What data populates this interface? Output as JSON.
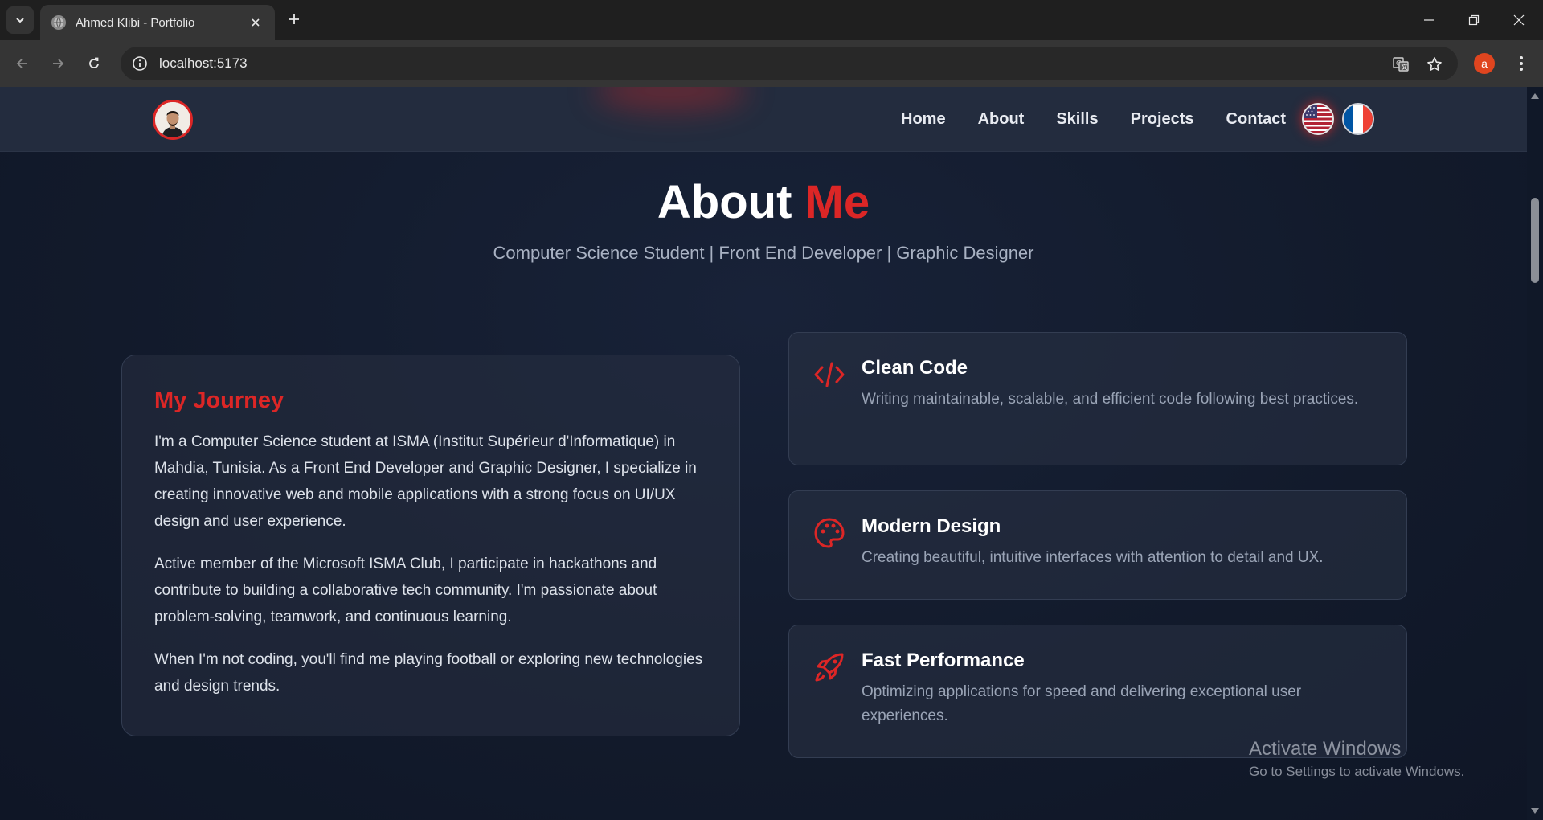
{
  "browser": {
    "tab_title": "Ahmed Klibi - Portfolio",
    "url": "localhost:5173"
  },
  "nav": {
    "items": [
      "Home",
      "About",
      "Skills",
      "Projects",
      "Contact"
    ]
  },
  "hero": {
    "title_main": "About",
    "title_accent": "Me",
    "subtitle": "Computer Science Student | Front End Developer | Graphic Designer"
  },
  "journey": {
    "title": "My Journey",
    "paragraphs": [
      "I'm a Computer Science student at ISMA (Institut Supérieur d'Informatique) in Mahdia, Tunisia. As a Front End Developer and Graphic Designer, I specialize in creating innovative web and mobile applications with a strong focus on UI/UX design and user experience.",
      "Active member of the Microsoft ISMA Club, I participate in hackathons and contribute to building a collaborative tech community. I'm passionate about problem-solving, teamwork, and continuous learning.",
      "When I'm not coding, you'll find me playing football or exploring new technologies and design trends."
    ]
  },
  "features": [
    {
      "icon": "code-icon",
      "title": "Clean Code",
      "description": "Writing maintainable, scalable, and efficient code following best practices."
    },
    {
      "icon": "palette-icon",
      "title": "Modern Design",
      "description": "Creating beautiful, intuitive interfaces with attention to detail and UX."
    },
    {
      "icon": "rocket-icon",
      "title": "Fast Performance",
      "description": "Optimizing applications for speed and delivering exceptional user experiences."
    }
  ],
  "watermark": {
    "line1": "Activate Windows",
    "line2": "Go to Settings to activate Windows."
  },
  "profile_initial": "a",
  "colors": {
    "accent": "#dc2626",
    "background": "#141b2c",
    "card": "#283042"
  }
}
